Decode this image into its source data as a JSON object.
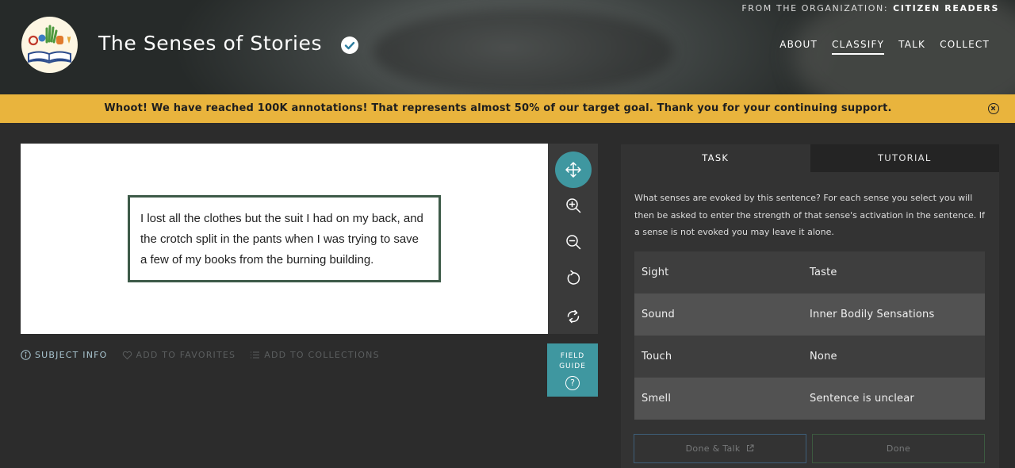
{
  "header": {
    "org_prefix": "FROM THE ORGANIZATION:",
    "org_name": "CITIZEN READERS",
    "project_title": "The Senses of Stories",
    "nav": [
      {
        "label": "ABOUT",
        "active": false
      },
      {
        "label": "CLASSIFY",
        "active": true
      },
      {
        "label": "TALK",
        "active": false
      },
      {
        "label": "COLLECT",
        "active": false
      }
    ]
  },
  "banner": {
    "message": "Whoot! We have reached 100K annotations! That represents almost 50% of our target goal. Thank you for your continuing support.",
    "color": "#e9b43d"
  },
  "subject": {
    "text": "I lost all the clothes but the suit I had on my back, and the crotch split in the pants when I was trying to save a few of my books from the burning building."
  },
  "tools": [
    "move-icon",
    "zoom-in-icon",
    "zoom-out-icon",
    "rotate-icon",
    "reset-icon"
  ],
  "field_guide": {
    "label": "FIELD\nGUIDE",
    "icon": "?"
  },
  "meta_bar": {
    "subject_info": "SUBJECT INFO",
    "add_to_favorites": "ADD TO FAVORITES",
    "add_to_collections": "ADD TO COLLECTIONS"
  },
  "task": {
    "tabs": [
      {
        "label": "TASK",
        "active": true
      },
      {
        "label": "TUTORIAL",
        "active": false
      }
    ],
    "question": "What senses are evoked by this sentence? For each sense you select you will then be asked to enter the strength of that sense's activation in the sentence. If a sense is not evoked you may leave it alone.",
    "choices": [
      [
        "Sight",
        "Taste"
      ],
      [
        "Sound",
        "Inner Bodily Sensations"
      ],
      [
        "Touch",
        "None"
      ],
      [
        "Smell",
        "Sentence is unclear"
      ]
    ],
    "done_talk_label": "Done & Talk",
    "done_label": "Done"
  },
  "colors": {
    "accent": "#3f97a0",
    "banner": "#e9b43d",
    "subject_border": "#3d5a48"
  }
}
